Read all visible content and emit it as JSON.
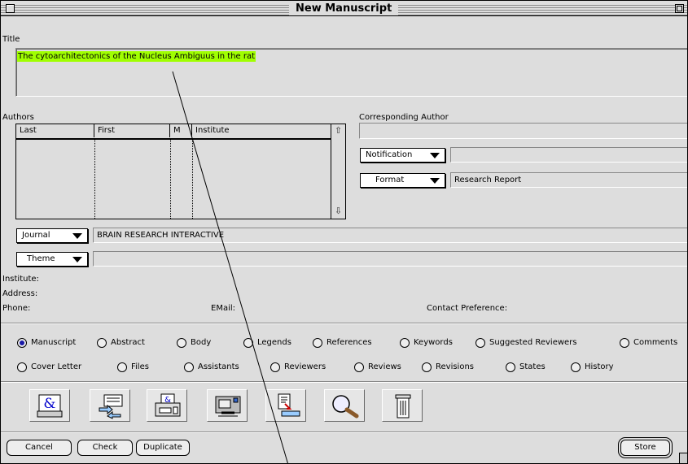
{
  "window": {
    "title": "New Manuscript"
  },
  "title_section": {
    "label": "Title",
    "value": "The cytoarchitectonics of the Nucleus Ambiguus in the rat"
  },
  "authors": {
    "label": "Authors",
    "columns": [
      "Last",
      "First",
      "M",
      "Institute"
    ],
    "rows": []
  },
  "corresponding_author": {
    "label": "Corresponding Author",
    "value": ""
  },
  "notification": {
    "label": "Notification",
    "value": ""
  },
  "format": {
    "label": "Format",
    "value": "Research Report"
  },
  "journal": {
    "label": "Journal",
    "value": "BRAIN RESEARCH INTERACTIVE"
  },
  "theme": {
    "label": "Theme",
    "value": ""
  },
  "contact": {
    "institute_label": "Institute:",
    "address_label": "Address:",
    "phone_label": "Phone:",
    "email_label": "EMail:",
    "contact_pref_label": "Contact Preference:"
  },
  "sections": {
    "row1": [
      "Manuscript",
      "Abstract",
      "Body",
      "Legends",
      "References",
      "Keywords",
      "Suggested Reviewers",
      "Comments"
    ],
    "row2": [
      "Cover Letter",
      "Files",
      "Assistants",
      "Reviewers",
      "Reviews",
      "Revisions",
      "States",
      "History"
    ],
    "selected": "Manuscript"
  },
  "toolbar_icons": [
    "document-ampersand-icon",
    "transfer-arrows-icon",
    "printer-icon",
    "fax-machine-icon",
    "document-submit-icon",
    "magnifier-icon",
    "trash-icon"
  ],
  "buttons": {
    "cancel": "Cancel",
    "check": "Check",
    "duplicate": "Duplicate",
    "store": "Store"
  }
}
